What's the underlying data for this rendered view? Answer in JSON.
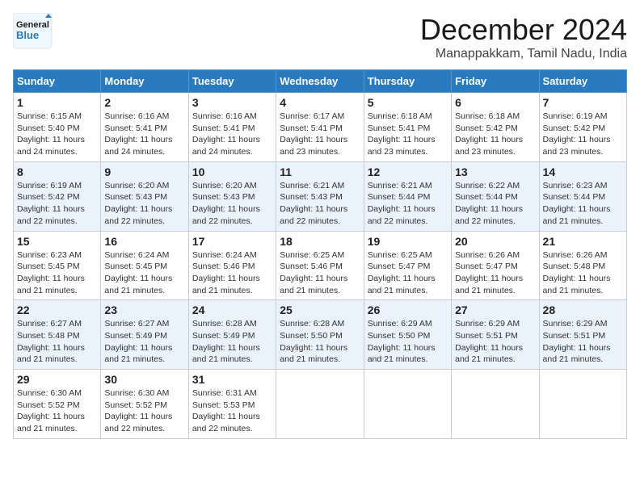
{
  "logo": {
    "text_general": "General",
    "text_blue": "Blue"
  },
  "header": {
    "month_year": "December 2024",
    "location": "Manappakkam, Tamil Nadu, India"
  },
  "weekdays": [
    "Sunday",
    "Monday",
    "Tuesday",
    "Wednesday",
    "Thursday",
    "Friday",
    "Saturday"
  ],
  "weeks": [
    [
      {
        "day": "1",
        "sunrise": "Sunrise: 6:15 AM",
        "sunset": "Sunset: 5:40 PM",
        "daylight": "Daylight: 11 hours and 24 minutes."
      },
      {
        "day": "2",
        "sunrise": "Sunrise: 6:16 AM",
        "sunset": "Sunset: 5:41 PM",
        "daylight": "Daylight: 11 hours and 24 minutes."
      },
      {
        "day": "3",
        "sunrise": "Sunrise: 6:16 AM",
        "sunset": "Sunset: 5:41 PM",
        "daylight": "Daylight: 11 hours and 24 minutes."
      },
      {
        "day": "4",
        "sunrise": "Sunrise: 6:17 AM",
        "sunset": "Sunset: 5:41 PM",
        "daylight": "Daylight: 11 hours and 23 minutes."
      },
      {
        "day": "5",
        "sunrise": "Sunrise: 6:18 AM",
        "sunset": "Sunset: 5:41 PM",
        "daylight": "Daylight: 11 hours and 23 minutes."
      },
      {
        "day": "6",
        "sunrise": "Sunrise: 6:18 AM",
        "sunset": "Sunset: 5:42 PM",
        "daylight": "Daylight: 11 hours and 23 minutes."
      },
      {
        "day": "7",
        "sunrise": "Sunrise: 6:19 AM",
        "sunset": "Sunset: 5:42 PM",
        "daylight": "Daylight: 11 hours and 23 minutes."
      }
    ],
    [
      {
        "day": "8",
        "sunrise": "Sunrise: 6:19 AM",
        "sunset": "Sunset: 5:42 PM",
        "daylight": "Daylight: 11 hours and 22 minutes."
      },
      {
        "day": "9",
        "sunrise": "Sunrise: 6:20 AM",
        "sunset": "Sunset: 5:43 PM",
        "daylight": "Daylight: 11 hours and 22 minutes."
      },
      {
        "day": "10",
        "sunrise": "Sunrise: 6:20 AM",
        "sunset": "Sunset: 5:43 PM",
        "daylight": "Daylight: 11 hours and 22 minutes."
      },
      {
        "day": "11",
        "sunrise": "Sunrise: 6:21 AM",
        "sunset": "Sunset: 5:43 PM",
        "daylight": "Daylight: 11 hours and 22 minutes."
      },
      {
        "day": "12",
        "sunrise": "Sunrise: 6:21 AM",
        "sunset": "Sunset: 5:44 PM",
        "daylight": "Daylight: 11 hours and 22 minutes."
      },
      {
        "day": "13",
        "sunrise": "Sunrise: 6:22 AM",
        "sunset": "Sunset: 5:44 PM",
        "daylight": "Daylight: 11 hours and 22 minutes."
      },
      {
        "day": "14",
        "sunrise": "Sunrise: 6:23 AM",
        "sunset": "Sunset: 5:44 PM",
        "daylight": "Daylight: 11 hours and 21 minutes."
      }
    ],
    [
      {
        "day": "15",
        "sunrise": "Sunrise: 6:23 AM",
        "sunset": "Sunset: 5:45 PM",
        "daylight": "Daylight: 11 hours and 21 minutes."
      },
      {
        "day": "16",
        "sunrise": "Sunrise: 6:24 AM",
        "sunset": "Sunset: 5:45 PM",
        "daylight": "Daylight: 11 hours and 21 minutes."
      },
      {
        "day": "17",
        "sunrise": "Sunrise: 6:24 AM",
        "sunset": "Sunset: 5:46 PM",
        "daylight": "Daylight: 11 hours and 21 minutes."
      },
      {
        "day": "18",
        "sunrise": "Sunrise: 6:25 AM",
        "sunset": "Sunset: 5:46 PM",
        "daylight": "Daylight: 11 hours and 21 minutes."
      },
      {
        "day": "19",
        "sunrise": "Sunrise: 6:25 AM",
        "sunset": "Sunset: 5:47 PM",
        "daylight": "Daylight: 11 hours and 21 minutes."
      },
      {
        "day": "20",
        "sunrise": "Sunrise: 6:26 AM",
        "sunset": "Sunset: 5:47 PM",
        "daylight": "Daylight: 11 hours and 21 minutes."
      },
      {
        "day": "21",
        "sunrise": "Sunrise: 6:26 AM",
        "sunset": "Sunset: 5:48 PM",
        "daylight": "Daylight: 11 hours and 21 minutes."
      }
    ],
    [
      {
        "day": "22",
        "sunrise": "Sunrise: 6:27 AM",
        "sunset": "Sunset: 5:48 PM",
        "daylight": "Daylight: 11 hours and 21 minutes."
      },
      {
        "day": "23",
        "sunrise": "Sunrise: 6:27 AM",
        "sunset": "Sunset: 5:49 PM",
        "daylight": "Daylight: 11 hours and 21 minutes."
      },
      {
        "day": "24",
        "sunrise": "Sunrise: 6:28 AM",
        "sunset": "Sunset: 5:49 PM",
        "daylight": "Daylight: 11 hours and 21 minutes."
      },
      {
        "day": "25",
        "sunrise": "Sunrise: 6:28 AM",
        "sunset": "Sunset: 5:50 PM",
        "daylight": "Daylight: 11 hours and 21 minutes."
      },
      {
        "day": "26",
        "sunrise": "Sunrise: 6:29 AM",
        "sunset": "Sunset: 5:50 PM",
        "daylight": "Daylight: 11 hours and 21 minutes."
      },
      {
        "day": "27",
        "sunrise": "Sunrise: 6:29 AM",
        "sunset": "Sunset: 5:51 PM",
        "daylight": "Daylight: 11 hours and 21 minutes."
      },
      {
        "day": "28",
        "sunrise": "Sunrise: 6:29 AM",
        "sunset": "Sunset: 5:51 PM",
        "daylight": "Daylight: 11 hours and 21 minutes."
      }
    ],
    [
      {
        "day": "29",
        "sunrise": "Sunrise: 6:30 AM",
        "sunset": "Sunset: 5:52 PM",
        "daylight": "Daylight: 11 hours and 21 minutes."
      },
      {
        "day": "30",
        "sunrise": "Sunrise: 6:30 AM",
        "sunset": "Sunset: 5:52 PM",
        "daylight": "Daylight: 11 hours and 22 minutes."
      },
      {
        "day": "31",
        "sunrise": "Sunrise: 6:31 AM",
        "sunset": "Sunset: 5:53 PM",
        "daylight": "Daylight: 11 hours and 22 minutes."
      },
      null,
      null,
      null,
      null
    ]
  ]
}
